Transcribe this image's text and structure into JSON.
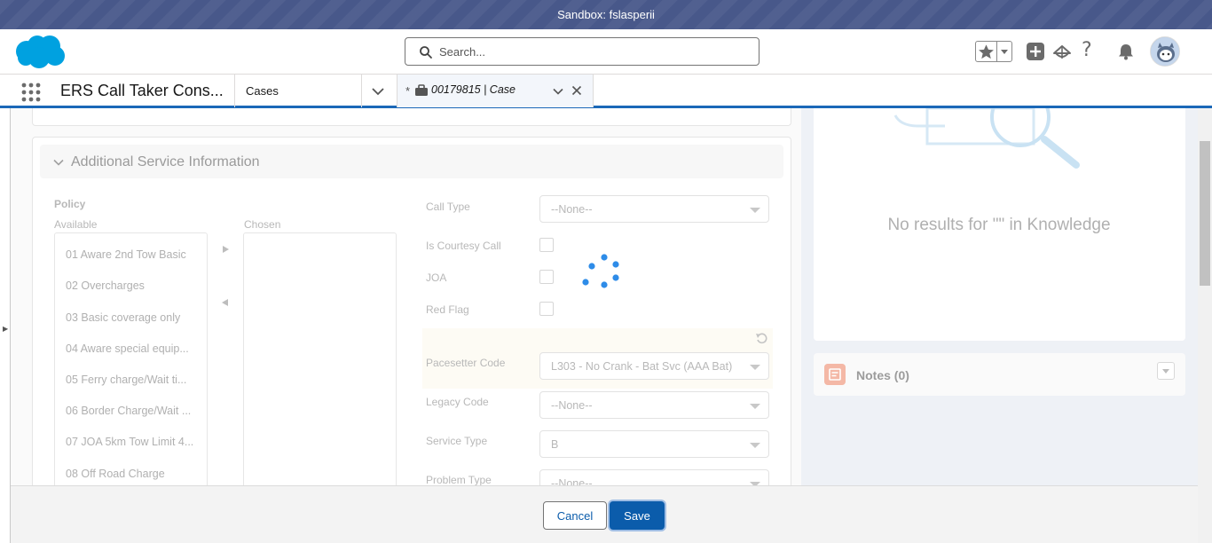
{
  "sandbox": {
    "text": "Sandbox: fslasperii"
  },
  "header": {
    "search_placeholder": "Search...",
    "help_glyph": "?"
  },
  "nav": {
    "app_name": "ERS Call Taker Cons...",
    "cases_label": "Cases",
    "active_tab": {
      "modified_mark": "*",
      "label": "00179815 | Case"
    }
  },
  "section": {
    "title": "Additional Service Information"
  },
  "policy": {
    "title": "Policy",
    "available_label": "Available",
    "chosen_label": "Chosen",
    "available_options": [
      "01 Aware 2nd Tow Basic",
      "02 Overcharges",
      "03 Basic coverage only",
      "04 Aware special equip...",
      "05 Ferry charge/Wait ti...",
      "06 Border Charge/Wait ...",
      "07 JOA 5km Tow Limit 4...",
      "08 Off Road Charge"
    ]
  },
  "fields": {
    "call_type": {
      "label": "Call Type",
      "value": "--None--"
    },
    "is_courtesy_call": {
      "label": "Is Courtesy Call"
    },
    "joa": {
      "label": "JOA"
    },
    "red_flag": {
      "label": "Red Flag"
    },
    "pacesetter_code": {
      "label": "Pacesetter Code",
      "value": "L303 - No Crank - Bat Svc (AAA Bat)"
    },
    "legacy_code": {
      "label": "Legacy Code",
      "value": "--None--"
    },
    "service_type": {
      "label": "Service Type",
      "value": "B"
    },
    "problem_type": {
      "label": "Problem Type",
      "value": "--None--"
    }
  },
  "knowledge": {
    "message": "No results for \"\" in Knowledge"
  },
  "notes": {
    "title": "Notes (0)"
  },
  "footer": {
    "cancel_label": "Cancel",
    "save_label": "Save"
  },
  "colors": {
    "brand_blue": "#0b5cab",
    "sandbox_bar": "#48588a",
    "spinner": "#1b96ff"
  }
}
